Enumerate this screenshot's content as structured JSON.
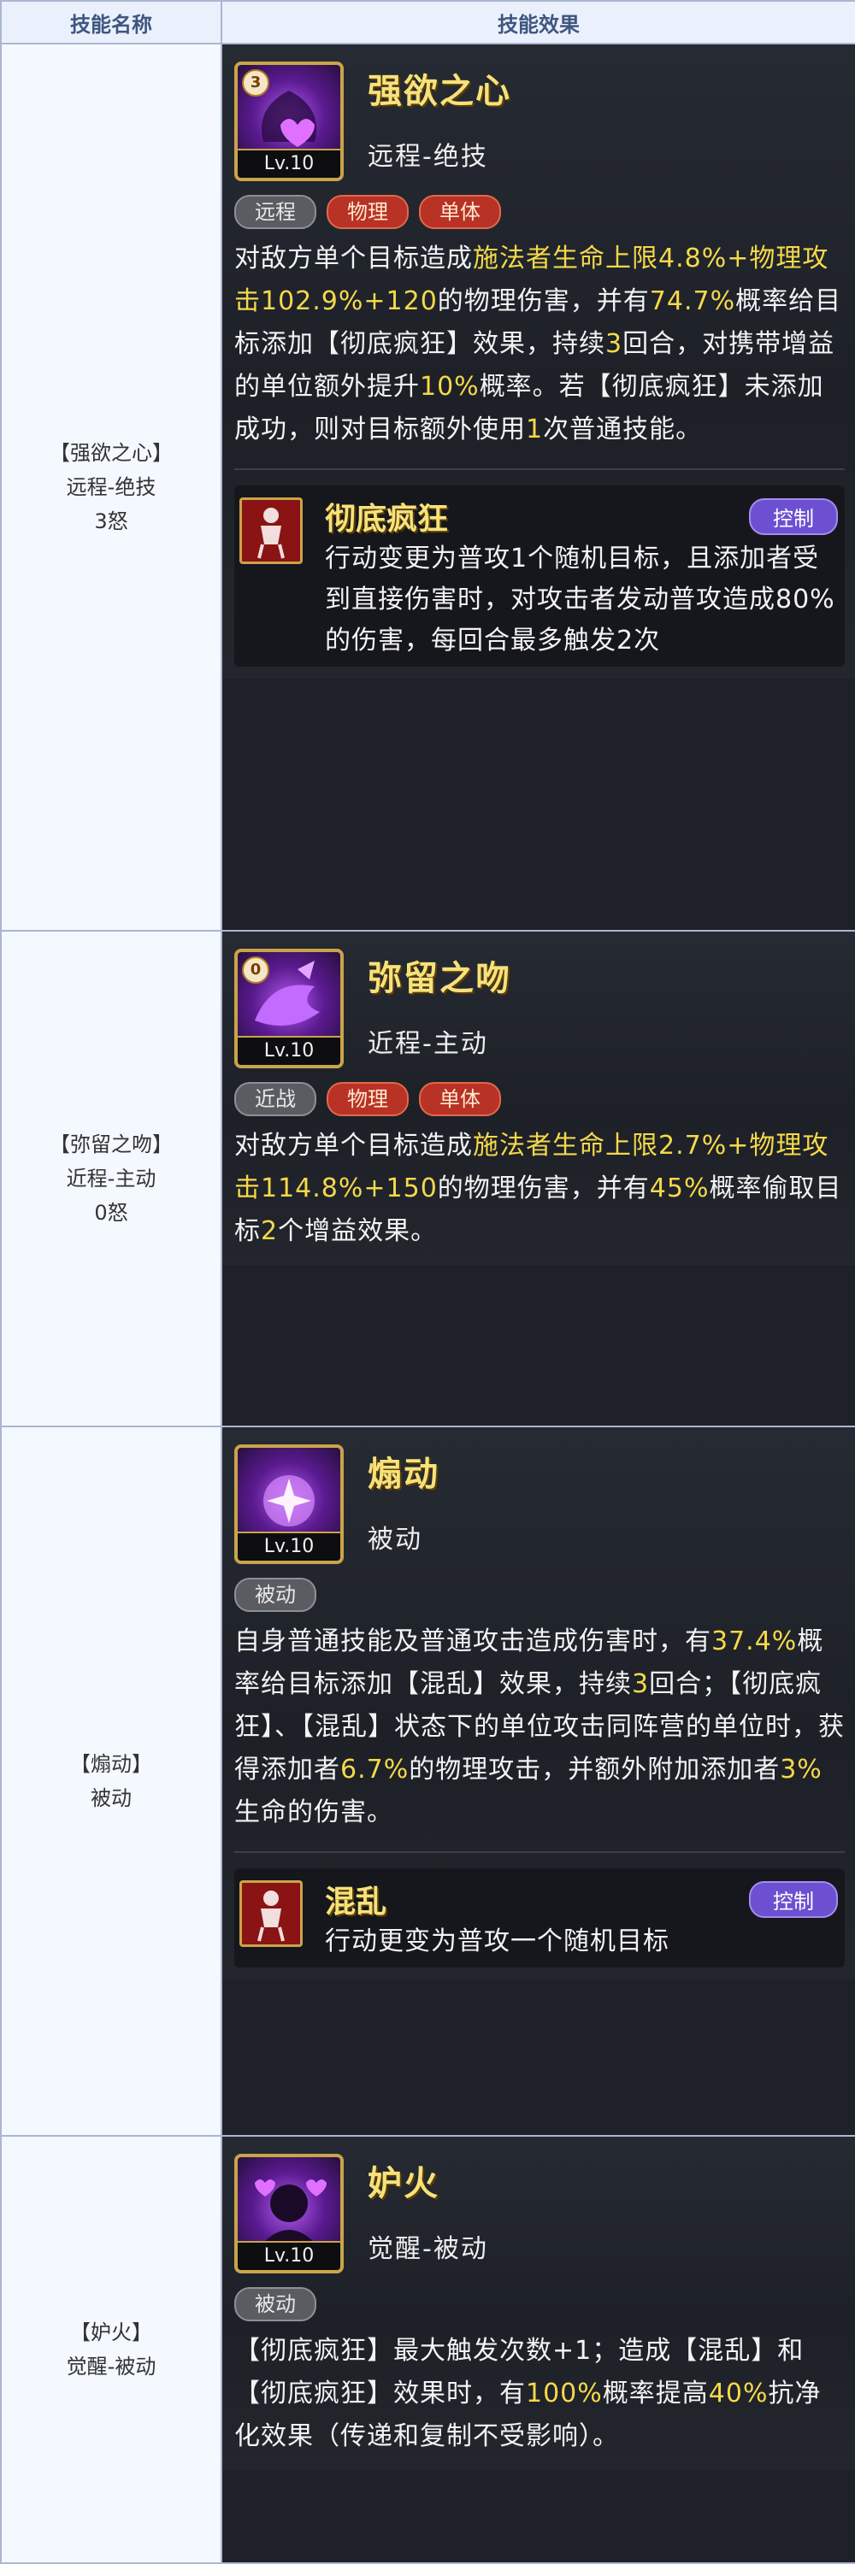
{
  "headers": {
    "name": "技能名称",
    "effect": "技能效果"
  },
  "skills": [
    {
      "name_label": "【强欲之心】",
      "type_label": "远程-绝技",
      "rage_label": "3怒",
      "title": "强欲之心",
      "type": "远程-绝技",
      "level": "Lv.10",
      "rage": "3",
      "tags": [
        "远程",
        "物理",
        "单体"
      ],
      "desc": [
        {
          "t": "对敌方单个目标造成"
        },
        {
          "t": "施法者生命上限4.8%+物理攻击102.9%+120",
          "h": true
        },
        {
          "t": "的物理伤害，并有"
        },
        {
          "t": "74.7%",
          "h": true
        },
        {
          "t": "概率给目标添加【彻底疯狂】效果，持续"
        },
        {
          "t": "3",
          "h": true
        },
        {
          "t": "回合，对携带增益的单位额外提升"
        },
        {
          "t": "10%",
          "h": true
        },
        {
          "t": "概率。若【彻底疯狂】未添加成功，则对目标额外使用"
        },
        {
          "t": "1",
          "h": true
        },
        {
          "t": "次普通技能。"
        }
      ],
      "status": {
        "name": "彻底疯狂",
        "badge": "控制",
        "desc": [
          {
            "t": "行动变更为普攻"
          },
          {
            "t": "1",
            "h": true
          },
          {
            "t": "个随机目标，且添加者受到直接伤害时，对攻击者发动普攻造成"
          },
          {
            "t": "80%",
            "h": true
          },
          {
            "t": "的伤害，每回合最多触发"
          },
          {
            "t": "2",
            "h": true
          },
          {
            "t": "次"
          }
        ]
      }
    },
    {
      "name_label": "【弥留之吻】",
      "type_label": "近程-主动",
      "rage_label": "0怒",
      "title": "弥留之吻",
      "type": "近程-主动",
      "level": "Lv.10",
      "rage": "0",
      "tags": [
        "近战",
        "物理",
        "单体"
      ],
      "desc": [
        {
          "t": "对敌方单个目标造成"
        },
        {
          "t": "施法者生命上限2.7%+物理攻击114.8%+150",
          "h": true
        },
        {
          "t": "的物理伤害，并有"
        },
        {
          "t": "45%",
          "h": true
        },
        {
          "t": "概率偷取目标"
        },
        {
          "t": "2",
          "h": true
        },
        {
          "t": "个增益效果。"
        }
      ]
    },
    {
      "name_label": "【煽动】",
      "type_label": "被动",
      "title": "煽动",
      "type": "被动",
      "level": "Lv.10",
      "tags": [
        "被动"
      ],
      "desc": [
        {
          "t": "自身普通技能及普通攻击造成伤害时，有"
        },
        {
          "t": "37.4%",
          "h": true
        },
        {
          "t": "概率给目标添加【混乱】效果，持续"
        },
        {
          "t": "3",
          "h": true
        },
        {
          "t": "回合；【彻底疯狂】、【混乱】状态下的单位攻击同阵营的单位时，获得添加者"
        },
        {
          "t": "6.7%",
          "h": true
        },
        {
          "t": "的物理攻击，并额外附加添加者"
        },
        {
          "t": "3%",
          "h": true
        },
        {
          "t": "生命的伤害。"
        }
      ],
      "status": {
        "name": "混乱",
        "badge": "控制",
        "desc": [
          {
            "t": "行动更变为普攻一个随机目标"
          }
        ]
      }
    },
    {
      "name_label": "【妒火】",
      "type_label": "觉醒-被动",
      "title": "妒火",
      "type": "觉醒-被动",
      "level": "Lv.10",
      "tags": [
        "被动"
      ],
      "desc": [
        {
          "t": "【彻底疯狂】最大触发次数+1；造成【混乱】和【彻底疯狂】效果时，有"
        },
        {
          "t": "100%",
          "h": true
        },
        {
          "t": "概率提高"
        },
        {
          "t": "40%",
          "h": true
        },
        {
          "t": "抗净化效果（传递和复制不受影响）。"
        }
      ]
    }
  ],
  "colors": {
    "highlight": "#f5d94a",
    "title": "#f6e27a",
    "control_badge": "#6d4fd1",
    "tag_red": "#b83226"
  }
}
